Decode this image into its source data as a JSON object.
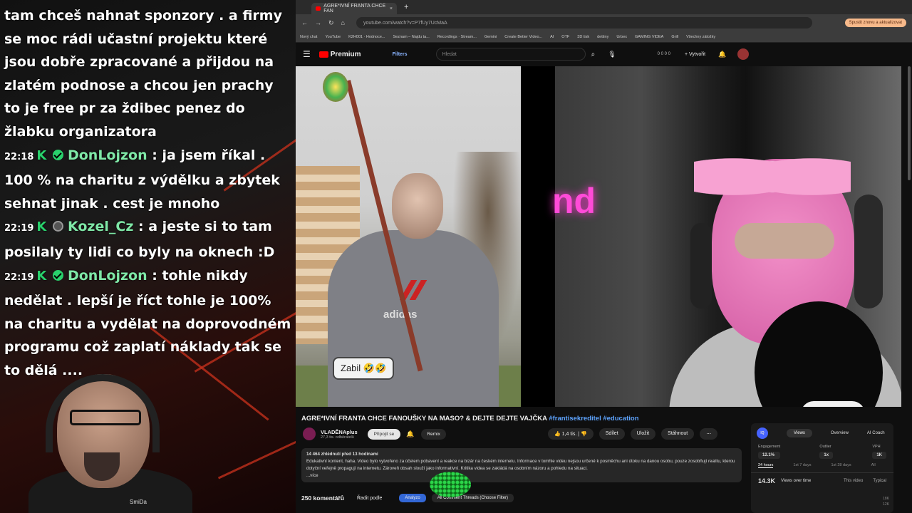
{
  "chat": {
    "messages": [
      {
        "time": "",
        "badges": [],
        "user": "",
        "text": "tam chceš nahnat sponzory . a firmy se moc rádi učastní projektu které jsou dobře zpracované a přijdou na zlatém podnose a chcou jen prachy to je free pr za ždibec penez do žlabku organizatora"
      },
      {
        "time": "22:18",
        "badges": [
          "k-badge",
          "verified-badge"
        ],
        "user": "DonLojzon",
        "text": ": ja jsem říkal . 100 % na charitu z výdělku a zbytek sehnat jinak . cest je mnoho"
      },
      {
        "time": "22:19",
        "badges": [
          "k-badge",
          "grey-badge"
        ],
        "user": "Kozel_Cz",
        "text": ": a jeste si to tam posilaly ty lidi co byly na oknech :D"
      },
      {
        "time": "22:19",
        "badges": [
          "k-badge",
          "verified-badge"
        ],
        "user": "DonLojzon",
        "text": ": tohle nikdy nedělat . lepší je říct tohle je 100% na charitu a vydělat na doprovodném programu což zaplatí náklady tak se to dělá ...."
      }
    ],
    "badge_k": "K",
    "cam_logo": "SmiDa"
  },
  "browser": {
    "tab_title": "AGRE*IVNÍ FRANTA CHCE FAN",
    "tab_close": "×",
    "new_tab": "+",
    "url": "youtube.com/watch?v=P7fUy7UcMaA",
    "update_button": "Spustit znovu a aktualizovat",
    "nav": [
      "←",
      "→",
      "↻",
      "⌂"
    ],
    "bookmarks": [
      "Nový chat",
      "YouTube",
      "K2H001 · Hodnoce...",
      "Seznam – Najdu ta...",
      "Recordings · Stream...",
      "Gemini",
      "Create Better Video...",
      "AI",
      "OTF",
      "3D tisk",
      "dettiny",
      "Urbex",
      "GAMING VIDEA",
      "Grill",
      "Všechny záložky"
    ]
  },
  "youtube": {
    "logo": "Premium",
    "filters": "Filters",
    "search_placeholder": "Hledat",
    "counters": "0  0  0  0",
    "create": "+ Vytvořit",
    "overlay_text": "Zabil 🤣🤣",
    "neon_text": "nd",
    "shirt_text": "adidas",
    "video_title": "AGRE*IVNÍ FRANTA CHCE FANOUŠKY NA MASO? & DEJTE DEJTE VAJČKA",
    "hashtags": "#frantisekreditel #education",
    "channel": {
      "name": "VLADĚNAplus",
      "subs": "27,3 tis. odběratelů",
      "join": "Připojit se",
      "remix": "Remix"
    },
    "actions": {
      "likes": "1,4 tis.",
      "share": "Sdílet",
      "save": "Uložit",
      "download": "Stáhnout",
      "more": "⋯"
    },
    "description": {
      "meta": "14 464 zhlédnutí  před 13 hodinami",
      "text": "Edukativní kontent, haha. Video bylo vytvořeno za účelem pobavení a reakce na bizár na českém internetu. Informace v tomhle videu nejsou určené k posměchu ani útoku na danou osobu, pouze zosobňují realitu, kterou dotyční veřejně propagují na internetu. Zároveň obsah slouží jako informativní. Kritika videa se zakládá na osobním názoru a pohledu na situaci.",
      "more": "...více"
    },
    "comments": {
      "count": "250 komentářů",
      "sort": "Řadit podle",
      "analyze": "Analyzo",
      "threads": "All Comment Threads (Choose Filter)"
    }
  },
  "vidiq": {
    "logo": "IQ",
    "tabs": [
      "Views",
      "Overview",
      "AI Coach"
    ],
    "stats": [
      {
        "label": "Engagement",
        "value": "12.1%"
      },
      {
        "label": "Outlier",
        "value": "1x"
      },
      {
        "label": "VPH",
        "value": "1K"
      }
    ],
    "ranges": [
      "24 hours",
      "1st 7 days",
      "1st 28 days",
      "All"
    ],
    "views_total": "14.3K",
    "views_dropdown": "Views over time",
    "this_video": "This video",
    "typical": "Typical",
    "y_ticks": [
      "18K",
      "12K"
    ]
  }
}
